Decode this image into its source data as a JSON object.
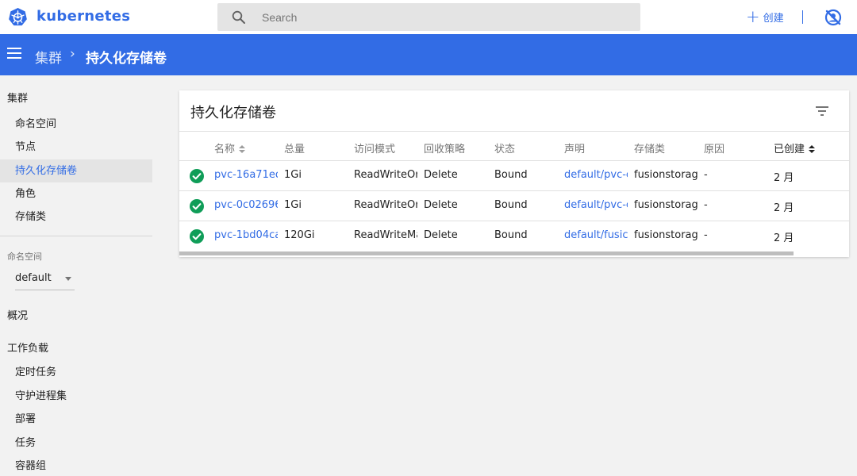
{
  "header": {
    "brand": "kubernetes",
    "search_placeholder": "Search",
    "create_label": "创建"
  },
  "breadcrumb": {
    "root": "集群",
    "separator": "›",
    "current": "持久化存储卷"
  },
  "sidebar": {
    "cluster_heading": "集群",
    "cluster_items": [
      {
        "label": "命名空间",
        "active": false
      },
      {
        "label": "节点",
        "active": false
      },
      {
        "label": "持久化存储卷",
        "active": true
      },
      {
        "label": "角色",
        "active": false
      },
      {
        "label": "存储类",
        "active": false
      }
    ],
    "namespace_label": "命名空间",
    "namespace_value": "default",
    "overview": "概况",
    "workloads_heading": "工作负载",
    "workload_items": [
      "定时任务",
      "守护进程集",
      "部署",
      "任务",
      "容器组"
    ]
  },
  "card": {
    "title": "持久化存储卷",
    "columns": [
      "名称",
      "总量",
      "访问模式",
      "回收策略",
      "状态",
      "声明",
      "存储类",
      "原因",
      "已创建"
    ],
    "rows": [
      {
        "name": "pvc-16a71ed",
        "capacity": "1Gi",
        "access": "ReadWriteOr",
        "reclaim": "Delete",
        "status": "Bound",
        "claim": "default/pvc-c",
        "storage_class": "fusionstorag",
        "reason": "-",
        "created": "2 月"
      },
      {
        "name": "pvc-0c02696",
        "capacity": "1Gi",
        "access": "ReadWriteOr",
        "reclaim": "Delete",
        "status": "Bound",
        "claim": "default/pvc-c",
        "storage_class": "fusionstorag",
        "reason": "-",
        "created": "2 月"
      },
      {
        "name": "pvc-1bd04ca",
        "capacity": "120Gi",
        "access": "ReadWriteMa",
        "reclaim": "Delete",
        "status": "Bound",
        "claim": "default/fusic",
        "storage_class": "fusionstorag",
        "reason": "-",
        "created": "2 月"
      }
    ]
  },
  "colors": {
    "accent": "#326ce5",
    "success": "#0f9d58"
  }
}
